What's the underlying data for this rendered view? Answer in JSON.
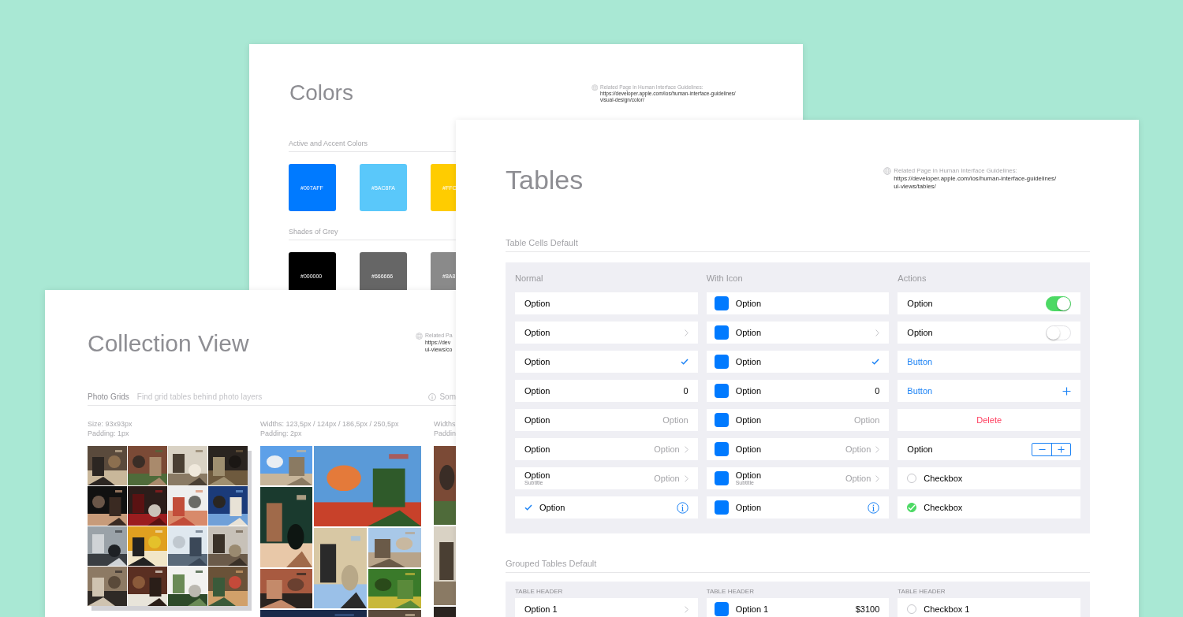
{
  "colors_page": {
    "title": "Colors",
    "related": {
      "label": "Related Page in Human Interface Guidelines:",
      "url_lines": [
        "https://developer.apple.com/ios/human-interface-guidelines/",
        "visual-design/color/"
      ]
    },
    "sections": [
      {
        "title": "Active and Accent Colors",
        "swatches": [
          {
            "label": "#007AFF",
            "color": "#007aff"
          },
          {
            "label": "#5AC8FA",
            "color": "#5ac8fa"
          },
          {
            "label": "#FFC",
            "color": "#ffcc00"
          }
        ]
      },
      {
        "title": "Shades of Grey",
        "swatches": [
          {
            "label": "#000000",
            "color": "#000000"
          },
          {
            "label": "#666666",
            "color": "#666666"
          },
          {
            "label": "#8A8",
            "color": "#8a8a8a"
          }
        ]
      }
    ]
  },
  "collection_page": {
    "title": "Collection View",
    "related": {
      "label": "Related Pa",
      "url_lines": [
        "https://dev",
        "ui-views/co"
      ]
    },
    "section": {
      "title": "Photo Grids",
      "hint": "Find grid tables behind photo layers",
      "note": "Som"
    },
    "grids": [
      {
        "kind": "square",
        "caption_lines": [
          "Size: 93x93px",
          "Padding: 1px"
        ],
        "photos": [
          {
            "kind": "picture"
          },
          {
            "kind": "picture"
          },
          {
            "kind": "picture"
          },
          {
            "kind": "picture"
          },
          {
            "kind": "picture"
          },
          {
            "kind": "picture"
          },
          {
            "kind": "picture"
          },
          {
            "kind": "picture"
          },
          {
            "kind": "picture"
          },
          {
            "kind": "picture"
          },
          {
            "kind": "picture"
          },
          {
            "kind": "picture"
          },
          {
            "kind": "picture"
          },
          {
            "kind": "picture"
          },
          {
            "kind": "picture"
          },
          {
            "kind": "picture"
          }
        ]
      },
      {
        "kind": "mosaic",
        "caption_lines": [
          "Widths: 123,5px /  124px / 186,5px / 250,5px",
          "Padding: 2px"
        ],
        "photos": [
          {
            "kind": "picture"
          },
          {
            "kind": "picture"
          },
          {
            "kind": "picture"
          },
          {
            "kind": "picture"
          },
          {
            "kind": "picture"
          },
          {
            "kind": "picture"
          },
          {
            "kind": "picture"
          },
          {
            "kind": "picture"
          },
          {
            "kind": "picture"
          }
        ]
      },
      {
        "kind": "strip",
        "caption_lines": [
          "Widths",
          "Paddin"
        ],
        "photos": [
          {
            "kind": "picture"
          },
          {
            "kind": "picture"
          },
          {
            "kind": "picture"
          }
        ]
      }
    ]
  },
  "tables_page": {
    "title": "Tables",
    "related": {
      "label": "Related Page in Human Interface Guidelines:",
      "url_lines": [
        "https://developer.apple.com/ios/human-interface-guidelines/",
        "ui-views/tables/"
      ]
    },
    "cells_section": {
      "title": "Table Cells Default",
      "columns": [
        {
          "header": "Normal",
          "kind": "text",
          "rows": [
            {
              "kind": "plain",
              "title": "Option"
            },
            {
              "kind": "chevron",
              "title": "Option"
            },
            {
              "kind": "check",
              "title": "Option"
            },
            {
              "kind": "value",
              "title": "Option",
              "detail": "0"
            },
            {
              "kind": "detail",
              "title": "Option",
              "detail": "Option"
            },
            {
              "kind": "detail-chevron",
              "title": "Option",
              "detail": "Option"
            },
            {
              "kind": "subtitle",
              "title": "Option",
              "subtitle": "Subtitle",
              "detail": "Option"
            },
            {
              "kind": "checked-info",
              "title": "Option"
            }
          ]
        },
        {
          "header": "With Icon",
          "kind": "icon",
          "rows": [
            {
              "kind": "plain",
              "title": "Option"
            },
            {
              "kind": "chevron",
              "title": "Option"
            },
            {
              "kind": "check",
              "title": "Option"
            },
            {
              "kind": "value",
              "title": "Option",
              "detail": "0"
            },
            {
              "kind": "detail",
              "title": "Option",
              "detail": "Option"
            },
            {
              "kind": "detail-chevron",
              "title": "Option",
              "detail": "Option"
            },
            {
              "kind": "subtitle",
              "title": "Option",
              "subtitle": "Subtitle",
              "detail": "Option"
            },
            {
              "kind": "info",
              "title": "Option"
            }
          ]
        },
        {
          "header": "Actions",
          "kind": "text",
          "rows": [
            {
              "kind": "switch",
              "title": "Option",
              "on": true
            },
            {
              "kind": "switch",
              "title": "Option",
              "on": false
            },
            {
              "kind": "button",
              "title": "Button"
            },
            {
              "kind": "button-add",
              "title": "Button"
            },
            {
              "kind": "delete",
              "title": "Delete"
            },
            {
              "kind": "stepper",
              "title": "Option"
            },
            {
              "kind": "checkbox",
              "title": "Checkbox",
              "checked": false
            },
            {
              "kind": "checkbox",
              "title": "Checkbox",
              "checked": true
            }
          ]
        }
      ]
    },
    "grouped_section": {
      "title": "Grouped Tables Default",
      "columns": [
        {
          "header": "TABLE HEADER",
          "kind": "text",
          "rows": [
            {
              "kind": "chevron",
              "title": "Option 1"
            }
          ]
        },
        {
          "header": "TABLE HEADER",
          "kind": "icon",
          "rows": [
            {
              "kind": "value",
              "title": "Option 1",
              "detail": "$3100"
            }
          ]
        },
        {
          "header": "TABLE HEADER",
          "kind": "text",
          "rows": [
            {
              "kind": "checkbox",
              "title": "Checkbox 1",
              "checked": false
            }
          ]
        }
      ]
    }
  }
}
